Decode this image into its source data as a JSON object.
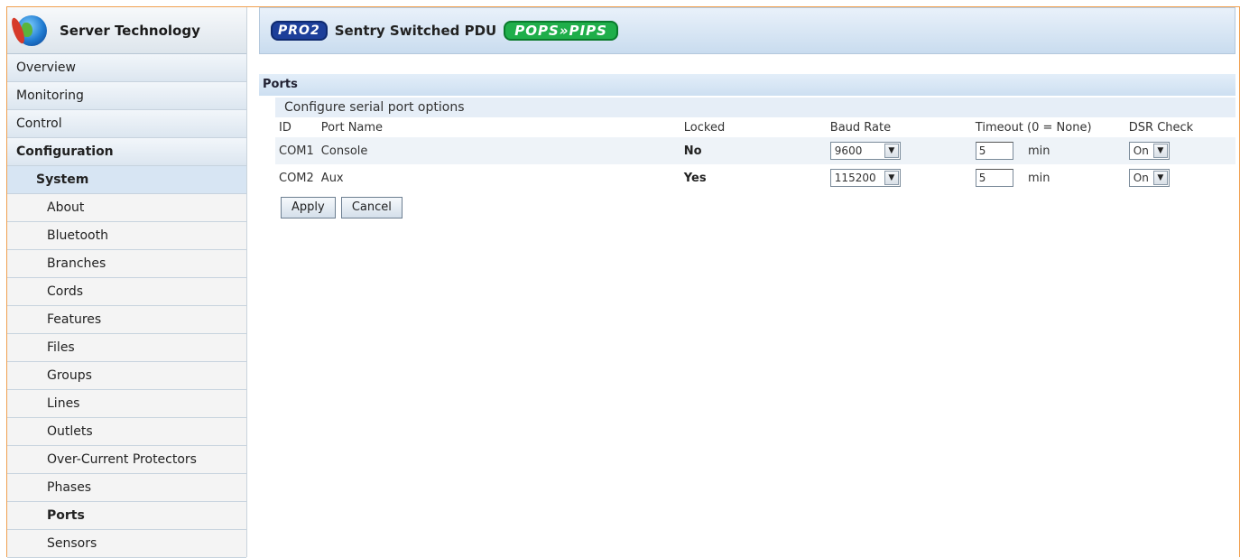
{
  "brand": {
    "name": "Server Technology"
  },
  "header": {
    "pro_badge": "PRO2",
    "title": "Sentry Switched PDU",
    "pops_badge": "POPS»PIPS"
  },
  "sidebar": {
    "items": [
      {
        "label": "Overview"
      },
      {
        "label": "Monitoring"
      },
      {
        "label": "Control"
      },
      {
        "label": "Configuration"
      },
      {
        "label": "System"
      },
      {
        "label": "About"
      },
      {
        "label": "Bluetooth"
      },
      {
        "label": "Branches"
      },
      {
        "label": "Cords"
      },
      {
        "label": "Features"
      },
      {
        "label": "Files"
      },
      {
        "label": "Groups"
      },
      {
        "label": "Lines"
      },
      {
        "label": "Outlets"
      },
      {
        "label": "Over-Current Protectors"
      },
      {
        "label": "Phases"
      },
      {
        "label": "Ports"
      },
      {
        "label": "Sensors"
      }
    ]
  },
  "main": {
    "section_title": "Ports",
    "section_subtitle": "Configure serial port options",
    "columns": [
      "ID",
      "Port Name",
      "Locked",
      "Baud Rate",
      "Timeout (0 = None)",
      "DSR Check"
    ],
    "rows": [
      {
        "id": "COM1",
        "name": "Console",
        "locked": "No",
        "baud": "9600",
        "timeout": "5",
        "unit": "min",
        "dsr": "On"
      },
      {
        "id": "COM2",
        "name": "Aux",
        "locked": "Yes",
        "baud": "115200",
        "timeout": "5",
        "unit": "min",
        "dsr": "On"
      }
    ],
    "apply_label": "Apply",
    "cancel_label": "Cancel"
  },
  "colors": {
    "accent_border": "#f0a050",
    "header_blue": "#c9dcef",
    "pro_blue": "#1d3f9a",
    "pops_green": "#1fae4a"
  }
}
